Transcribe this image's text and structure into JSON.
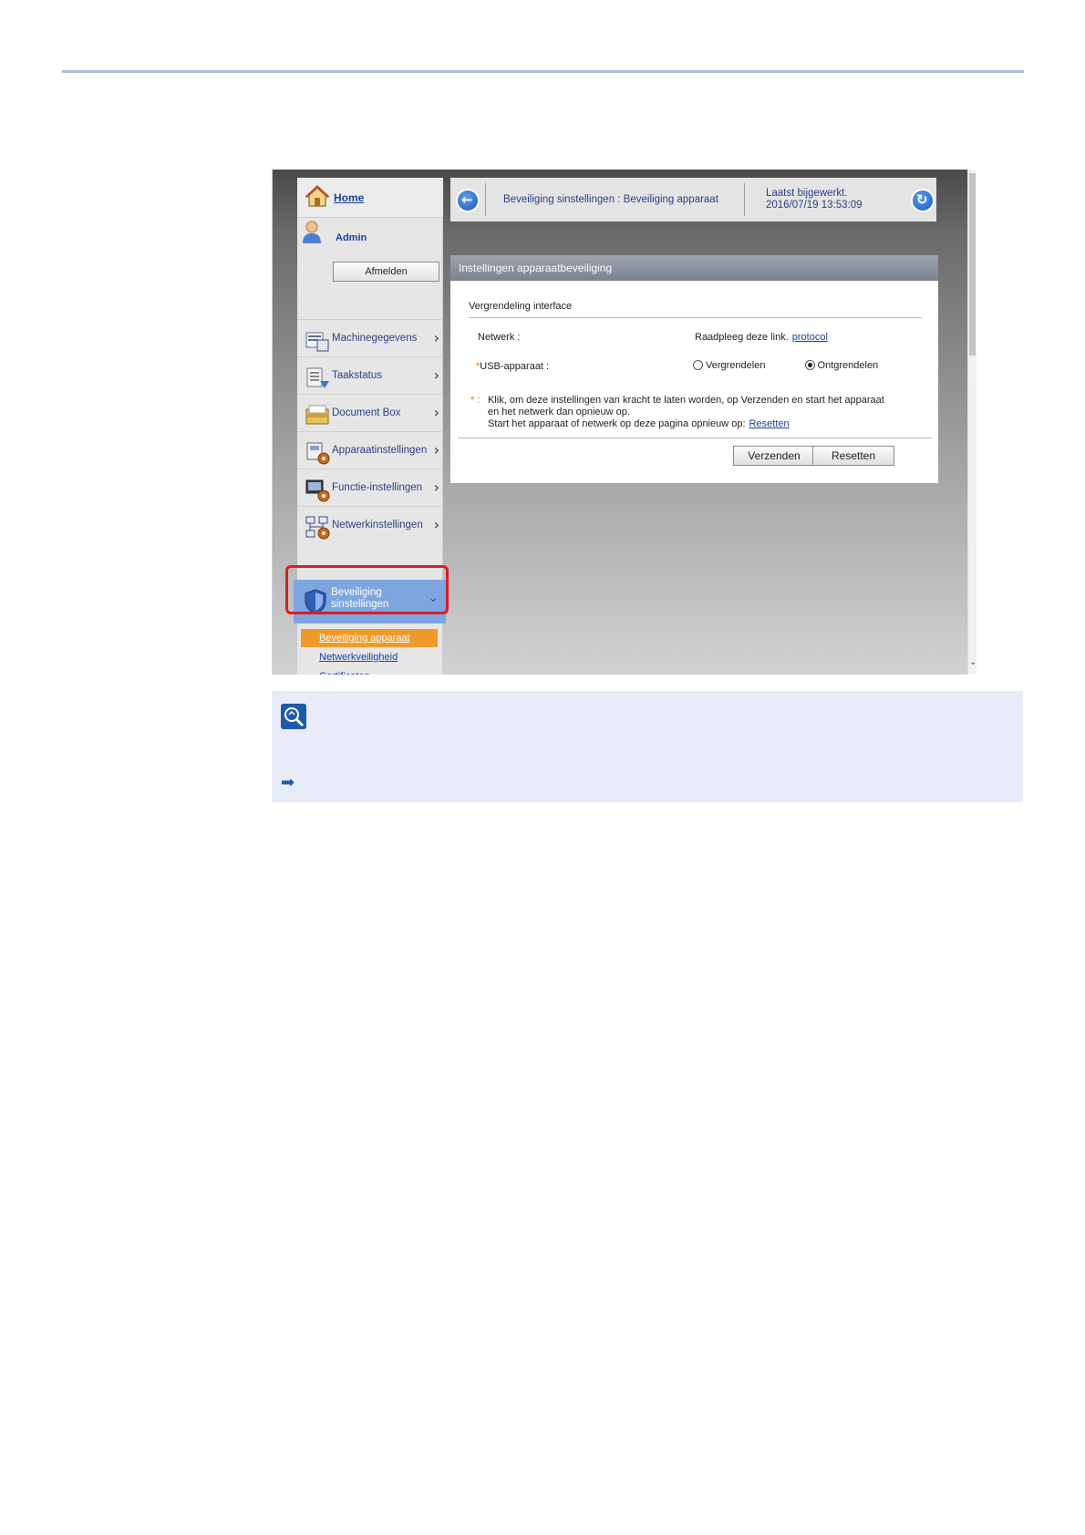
{
  "sidebar": {
    "home_label": "Home",
    "user_label": "Admin",
    "logout_label": "Afmelden",
    "items": [
      {
        "label": "Machinegegevens",
        "icon": "machine-info-icon"
      },
      {
        "label": "Taakstatus",
        "icon": "job-status-icon"
      },
      {
        "label": "Document Box",
        "icon": "document-box-icon"
      },
      {
        "label": "Apparaatinstellingen",
        "icon": "device-settings-icon"
      },
      {
        "label": "Functie-instellingen",
        "icon": "function-settings-icon"
      },
      {
        "label": "Netwerkinstellingen",
        "icon": "network-settings-icon"
      }
    ],
    "active_item": {
      "label": "Beveiliging sinstellingen",
      "icon": "shield-icon"
    },
    "sub_items": [
      {
        "label": "Beveiliging apparaat",
        "active": true
      },
      {
        "label": "Netwerkveiligheid",
        "active": false
      },
      {
        "label": "Certificaten",
        "active": false
      }
    ]
  },
  "breadcrumb": {
    "path": "Beveiliging sinstellingen : Beveiliging apparaat",
    "last_updated_label": "Laatst bijgewerkt.",
    "last_updated_value": "2016/07/19 13:53:09"
  },
  "panel": {
    "title": "Instellingen apparaatbeveiliging",
    "section_title": "Vergrendeling interface",
    "network_label": "Netwerk :",
    "network_text": "Raadpleeg deze link.",
    "network_link": "protocol",
    "usb_asterisk": "*",
    "usb_label": "USB-apparaat :",
    "usb_options": [
      {
        "label": "Vergrendelen",
        "selected": false
      },
      {
        "label": "Ontgrendelen",
        "selected": true
      }
    ],
    "note_asterisk": "* :",
    "note_line1": "Klik, om deze instellingen van kracht te laten worden, op Verzenden en start het apparaat en het netwerk dan opnieuw op.",
    "note_line2": "Start het apparaat of netwerk op deze pagina opnieuw op:",
    "note_link": "Resetten",
    "submit_label": "Verzenden",
    "reset_label": "Resetten"
  },
  "colors": {
    "accent_blue": "#7da6df",
    "highlight_orange": "#f09a2c",
    "callout_red": "#e01b22",
    "note_bg": "#e7ecf8"
  }
}
